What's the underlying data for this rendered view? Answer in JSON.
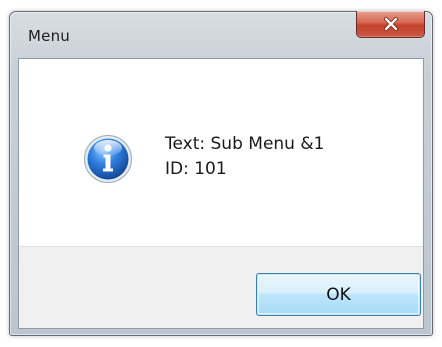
{
  "window": {
    "title": "Menu"
  },
  "icons": {
    "close": "close-icon",
    "info": "info-icon"
  },
  "message": {
    "text_line": "Text: Sub Menu &1",
    "id_line": "ID: 101"
  },
  "buttons": {
    "ok_label": "OK"
  },
  "colors": {
    "close_button": "#c3412a",
    "ok_border": "#3c7fb1",
    "info_blue": "#1f5fbf"
  }
}
